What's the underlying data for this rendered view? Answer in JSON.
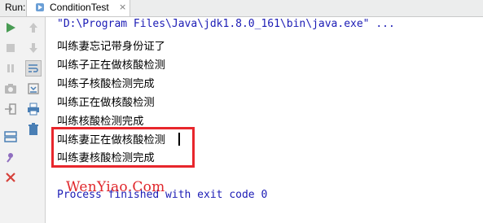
{
  "tabbar": {
    "run_label": "Run:",
    "tab_title": "ConditionTest",
    "close_glyph": "×"
  },
  "console": {
    "command_line": "\"D:\\Program Files\\Java\\jdk1.8.0_161\\bin\\java.exe\" ...",
    "output_lines": [
      "叫练妻忘记带身份证了",
      "叫练子正在做核酸检测",
      "叫练子核酸检测完成",
      "叫练正在做核酸检测",
      "叫练核酸检测完成",
      "叫练妻正在做核酸检测",
      "叫练妻核酸检测完成"
    ],
    "exit_line": "Process finished with exit code 0"
  },
  "watermark": "WenYiao.Com",
  "colors": {
    "accent_green": "#499c54",
    "highlight_red": "#e8262c",
    "console_blue": "#1b1bb5"
  }
}
